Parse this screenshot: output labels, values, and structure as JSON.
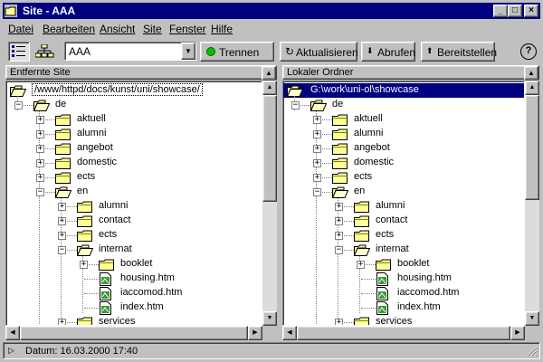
{
  "window": {
    "title": "Site - AAA",
    "minimize": "_",
    "maximize": "□",
    "close": "×"
  },
  "menu": [
    {
      "label": "Datei"
    },
    {
      "label": "Bearbeiten"
    },
    {
      "label": "Ansicht"
    },
    {
      "label": "Site"
    },
    {
      "label": "Fenster"
    },
    {
      "label": "Hilfe"
    }
  ],
  "toolbar": {
    "site_select": "AAA",
    "disconnect_label": "Trennen",
    "refresh_label": "Aktualisieren",
    "get_label": "Abrufen",
    "put_label": "Bereitstellen",
    "help_label": "?"
  },
  "remote": {
    "header": "Entfernte Site",
    "root_path": "/www/httpd/docs/kunst/uni/showcase/",
    "items": [
      {
        "label": "de",
        "type": "folder",
        "level": 0,
        "expanded": true
      },
      {
        "label": "aktuell",
        "type": "folder",
        "level": 1
      },
      {
        "label": "alumni",
        "type": "folder",
        "level": 1
      },
      {
        "label": "angebot",
        "type": "folder",
        "level": 1
      },
      {
        "label": "domestic",
        "type": "folder",
        "level": 1
      },
      {
        "label": "ects",
        "type": "folder",
        "level": 1
      },
      {
        "label": "en",
        "type": "folder",
        "level": 1,
        "expanded": true
      },
      {
        "label": "alumni",
        "type": "folder",
        "level": 2
      },
      {
        "label": "contact",
        "type": "folder",
        "level": 2
      },
      {
        "label": "ects",
        "type": "folder",
        "level": 2
      },
      {
        "label": "internat",
        "type": "folder",
        "level": 2,
        "expanded": true
      },
      {
        "label": "booklet",
        "type": "folder",
        "level": 3
      },
      {
        "label": "housing.htm",
        "type": "file",
        "level": 3
      },
      {
        "label": "iaccomod.htm",
        "type": "file",
        "level": 3
      },
      {
        "label": "index.htm",
        "type": "file",
        "level": 3
      },
      {
        "label": "services",
        "type": "folder",
        "level": 2
      }
    ]
  },
  "local": {
    "header": "Lokaler Ordner",
    "root_path": "G:\\work\\uni-ol\\showcase",
    "items": [
      {
        "label": "de",
        "type": "folder",
        "level": 0,
        "expanded": true
      },
      {
        "label": "aktuell",
        "type": "folder",
        "level": 1
      },
      {
        "label": "alumni",
        "type": "folder",
        "level": 1
      },
      {
        "label": "angebot",
        "type": "folder",
        "level": 1
      },
      {
        "label": "domestic",
        "type": "folder",
        "level": 1
      },
      {
        "label": "ects",
        "type": "folder",
        "level": 1
      },
      {
        "label": "en",
        "type": "folder",
        "level": 1,
        "expanded": true
      },
      {
        "label": "alumni",
        "type": "folder",
        "level": 2
      },
      {
        "label": "contact",
        "type": "folder",
        "level": 2
      },
      {
        "label": "ects",
        "type": "folder",
        "level": 2
      },
      {
        "label": "internat",
        "type": "folder",
        "level": 2,
        "expanded": true
      },
      {
        "label": "booklet",
        "type": "folder",
        "level": 3
      },
      {
        "label": "housing.htm",
        "type": "file",
        "level": 3
      },
      {
        "label": "iaccomod.htm",
        "type": "file",
        "level": 3
      },
      {
        "label": "index.htm",
        "type": "file",
        "level": 3
      },
      {
        "label": "services",
        "type": "folder",
        "level": 2
      }
    ]
  },
  "status": {
    "text": "Datum: 16.03.2000 17:40"
  },
  "colors": {
    "titlebar": "#000080",
    "selection": "#000080",
    "face": "#c0c0c0",
    "folder": "#ffff99",
    "connected_dot": "#00c000"
  }
}
